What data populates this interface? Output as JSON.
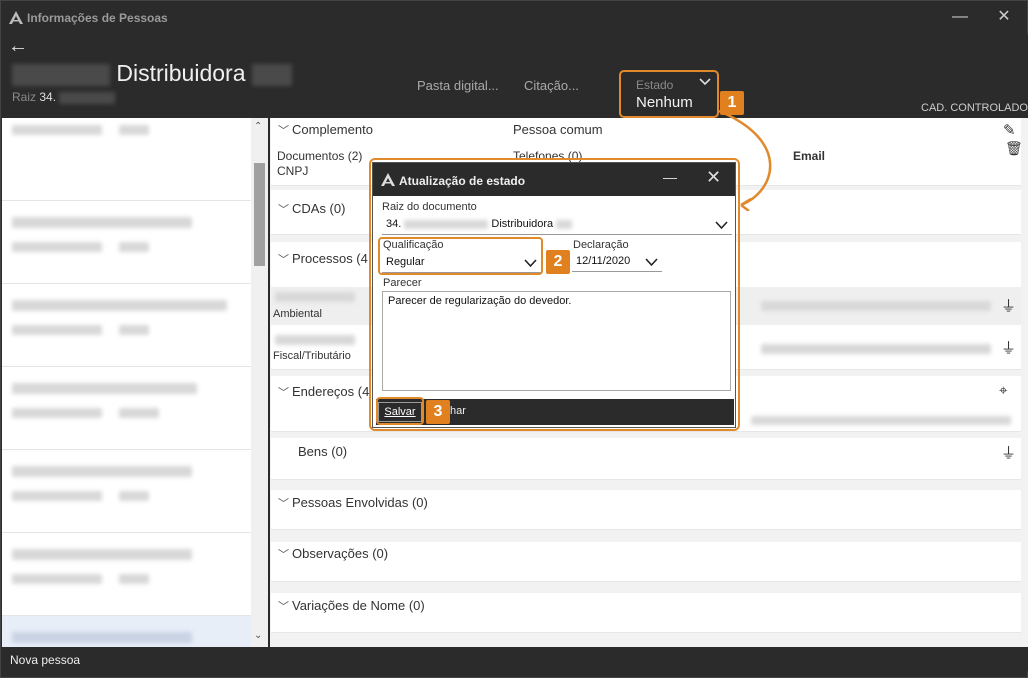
{
  "window": {
    "title": "Informações de Pessoas",
    "minimize": "—",
    "close": "✕"
  },
  "header": {
    "back": "←",
    "name": "Distribuidora",
    "raiz_label": "Raiz",
    "raiz_value": "34.",
    "links": [
      "Pasta digital...",
      "Citação..."
    ],
    "estado_label": "Estado",
    "estado_value": "Nenhum",
    "cad_label": "CAD. CONTROLADO"
  },
  "badges": [
    "1",
    "2",
    "3"
  ],
  "main": {
    "complemento": {
      "title": "Complemento",
      "pessoa": "Pessoa comum",
      "documentos": "Documentos (2)",
      "cnpj": "CNPJ",
      "telefones": "Telefones (0)",
      "email": "Email"
    },
    "cdas": "CDAs (0)",
    "processos": "Processos (4",
    "ambiental": "Ambiental",
    "fiscal": "Fiscal/Tributário",
    "enderecos": "Endereços (4",
    "bens": "Bens (0)",
    "envolvidas": "Pessoas Envolvidas (0)",
    "observacoes": "Observações (0)",
    "variacoes": "Variações de Nome (0)"
  },
  "footer": {
    "new_person": "Nova pessoa"
  },
  "dialog": {
    "title": "Atualização de estado",
    "raiz_label": "Raiz do documento",
    "raiz_value": "34.",
    "raiz_name": "Distribuidora",
    "qualificacao_label": "Qualificação",
    "qualificacao_value": "Regular",
    "declaracao_label": "Declaração",
    "declaracao_value": "12/11/2020",
    "parecer_label": "Parecer",
    "parecer_value": "Parecer de regularização do devedor.",
    "save": "Salvar",
    "cancel_partial": "har"
  },
  "colors": {
    "accent": "#e08a2c",
    "dark": "#2b2b2b"
  }
}
